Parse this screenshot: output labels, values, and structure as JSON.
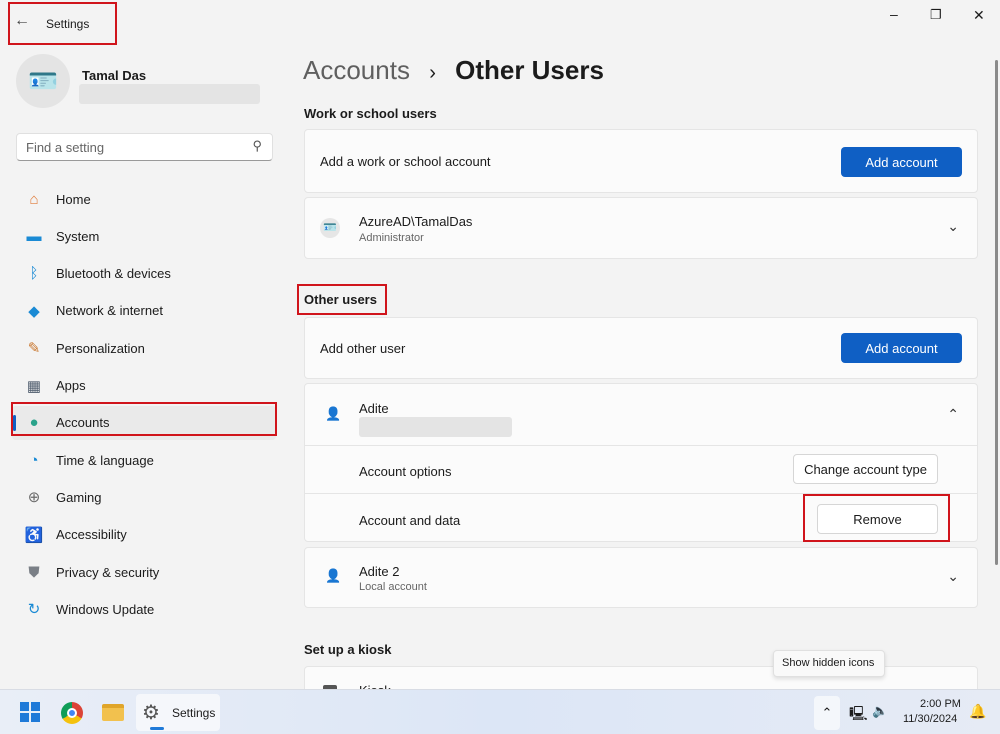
{
  "window": {
    "title": "Settings",
    "back_icon": "arrow-left-icon",
    "minimize": "–",
    "maximize": "❐",
    "close": "✕"
  },
  "user": {
    "name": "Tamal Das"
  },
  "search": {
    "placeholder": "Find a setting"
  },
  "sidebar": {
    "items": [
      {
        "label": "Home",
        "icon": "home-icon",
        "glyph": "⌂",
        "color": "#e07b39"
      },
      {
        "label": "System",
        "icon": "monitor-icon",
        "glyph": "▬",
        "color": "#1a8ad4"
      },
      {
        "label": "Bluetooth & devices",
        "icon": "bluetooth-icon",
        "glyph": "ᛒ",
        "color": "#1a8ad4"
      },
      {
        "label": "Network & internet",
        "icon": "wifi-icon",
        "glyph": "◆",
        "color": "#1a8ad4"
      },
      {
        "label": "Personalization",
        "icon": "brush-icon",
        "glyph": "✎",
        "color": "#c9762d"
      },
      {
        "label": "Apps",
        "icon": "apps-icon",
        "glyph": "▦",
        "color": "#4c5a6b"
      },
      {
        "label": "Accounts",
        "icon": "person-icon",
        "glyph": "●",
        "color": "#2aa38b"
      },
      {
        "label": "Time & language",
        "icon": "globe-clock-icon",
        "glyph": "◔",
        "color": "#1a8ad4"
      },
      {
        "label": "Gaming",
        "icon": "gamepad-icon",
        "glyph": "⊕",
        "color": "#6b6b6b"
      },
      {
        "label": "Accessibility",
        "icon": "accessibility-icon",
        "glyph": "♿",
        "color": "#1a6fd4"
      },
      {
        "label": "Privacy & security",
        "icon": "shield-icon",
        "glyph": "⛊",
        "color": "#7a7f86"
      },
      {
        "label": "Windows Update",
        "icon": "update-icon",
        "glyph": "↻",
        "color": "#1a8ad4"
      }
    ],
    "selected": "Accounts"
  },
  "breadcrumb": {
    "parent": "Accounts",
    "separator": "›",
    "current": "Other Users"
  },
  "work": {
    "heading": "Work or school users",
    "add_label": "Add a work or school account",
    "add_button": "Add account",
    "account_name": "AzureAD\\TamalDas",
    "account_role": "Administrator"
  },
  "other": {
    "heading": "Other users",
    "add_label": "Add other user",
    "add_button": "Add account",
    "user1": {
      "name": "Adite",
      "options_label": "Account options",
      "change_button": "Change account type",
      "data_label": "Account and data",
      "remove_button": "Remove"
    },
    "user2": {
      "name": "Adite 2",
      "type": "Local account"
    }
  },
  "kiosk": {
    "heading": "Set up a kiosk",
    "item": "Kiosk"
  },
  "taskbar": {
    "app_label": "Settings",
    "tooltip": "Show hidden icons",
    "time": "2:00 PM",
    "date": "11/30/2024"
  },
  "colors": {
    "accent": "#0f5fc4",
    "highlight": "#d0141b"
  }
}
